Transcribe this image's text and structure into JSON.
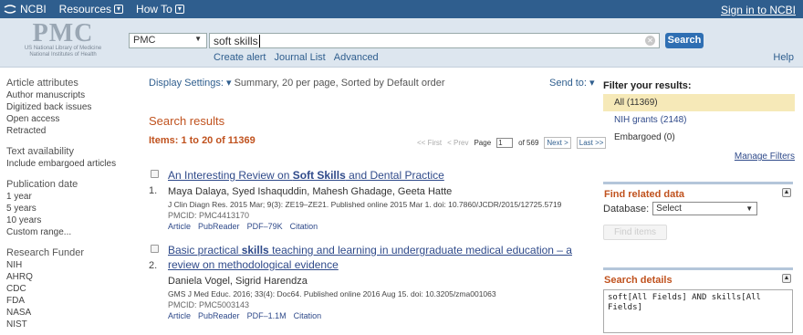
{
  "topbar": {
    "brand": "NCBI",
    "resources": "Resources",
    "howto": "How To",
    "signin": "Sign in to NCBI"
  },
  "header": {
    "logo": "PMC",
    "logo_sub1": "US National Library of Medicine",
    "logo_sub2": "National Institutes of Health",
    "db_selected": "PMC",
    "search_value": "soft skills",
    "search_button": "Search",
    "links": [
      "Create alert",
      "Journal List",
      "Advanced"
    ],
    "help": "Help"
  },
  "sidebar": {
    "groups": [
      {
        "title": "Article attributes",
        "items": [
          "Author manuscripts",
          "Digitized back issues",
          "Open access",
          "Retracted"
        ]
      },
      {
        "title": "Text availability",
        "items": [
          "Include embargoed articles"
        ]
      },
      {
        "title": "Publication date",
        "items": [
          "1 year",
          "5 years",
          "10 years",
          "Custom range..."
        ]
      },
      {
        "title": "Research Funder",
        "items": [
          "NIH",
          "AHRQ",
          "CDC",
          "FDA",
          "NASA",
          "NIST"
        ]
      }
    ]
  },
  "main": {
    "display_label": "Display Settings:",
    "display_value": "Summary, 20 per page, Sorted by Default order",
    "send_to": "Send to:",
    "results_title": "Search results",
    "items_count": "Items: 1 to 20 of 11369",
    "pager": {
      "first": "<< First",
      "prev": "< Prev",
      "page_label": "Page",
      "page_value": "1",
      "of": "of 569",
      "next": "Next >",
      "last": "Last >>"
    },
    "results": [
      {
        "num": "1.",
        "title_pre": "An Interesting Review on ",
        "title_bold": "Soft Skills",
        "title_post": " and Dental Practice",
        "authors": "Maya Dalaya, Syed Ishaquddin, Mahesh Ghadage, Geeta Hatte",
        "citation": "J Clin Diagn Res. 2015 Mar; 9(3): ZE19–ZE21. Published online 2015 Mar 1. doi: 10.7860/JCDR/2015/12725.5719",
        "pmcid": "PMCID: PMC4413170",
        "links": [
          "Article",
          "PubReader",
          "PDF–79K",
          "Citation"
        ]
      },
      {
        "num": "2.",
        "title_pre": "Basic practical ",
        "title_bold": "skills",
        "title_post": " teaching and learning in undergraduate medical education – a review on methodological evidence",
        "authors": "Daniela Vogel, Sigrid Harendza",
        "citation": "GMS J Med Educ. 2016; 33(4): Doc64. Published online 2016 Aug 15. doi: 10.3205/zma001063",
        "pmcid": "PMCID: PMC5003143",
        "links": [
          "Article",
          "PubReader",
          "PDF–1.1M",
          "Citation"
        ]
      }
    ]
  },
  "filters": {
    "title": "Filter your results:",
    "items": [
      "All (11369)",
      "NIH grants (2148)",
      "Embargoed (0)"
    ],
    "manage": "Manage Filters"
  },
  "related": {
    "title": "Find related data",
    "db_label": "Database:",
    "db_value": "Select",
    "find_button": "Find items"
  },
  "details": {
    "title": "Search details",
    "query": "soft[All Fields] AND skills[All Fields]"
  },
  "colors": {
    "topbar": "#2f5e8e",
    "header_bg": "#dde6ef",
    "accent_orange": "#c0521e",
    "link": "#2f4a8a",
    "search_button": "#2f6fb3",
    "filter_active": "#f6e9b8"
  }
}
